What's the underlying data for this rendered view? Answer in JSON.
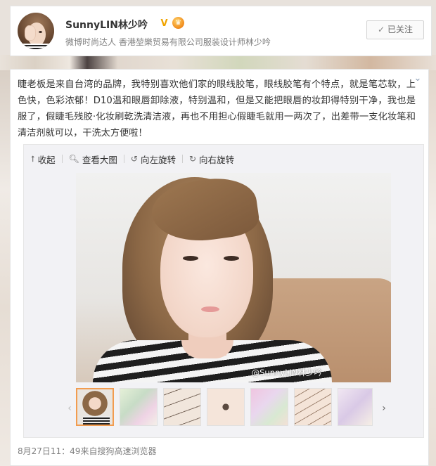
{
  "user": {
    "name": "SunnyLIN林少吟",
    "description": "微博时尚达人 香港堃樂贸易有限公司服装设计师林少吟",
    "follow_label": "已关注"
  },
  "post": {
    "text": "睫老板是来自台湾的品牌，我特别喜欢他们家的眼线胶笔，眼线胶笔有个特点，就是笔芯软，上色快，色彩浓郁！D10温和眼唇卸除液，特别温和，但是又能把眼唇的妆卸得特别干净，我也是服了，假睫毛残胶·化妆刷乾洗清洁液，再也不用担心假睫毛就用一两次了，出差带一支化妆笔和清洁剂就可以，干洗太方便啦！",
    "meta": "8月27日11：49来自搜狗高速浏览器"
  },
  "media": {
    "toolbar": {
      "collapse": "收起",
      "view_large": "查看大图",
      "rotate_left": "向左旋转",
      "rotate_right": "向右旋转"
    },
    "watermark": "@SunnyLIN林少吟",
    "thumbnails_count": 7,
    "active_thumbnail": 1
  },
  "icons": {
    "collapse": "arrow-up-icon",
    "view_large": "magnifier-icon",
    "rotate_left": "rotate-left-icon",
    "rotate_right": "rotate-right-icon",
    "follow": "check-icon",
    "post_menu": "chevron-down-icon"
  },
  "colors": {
    "accent_orange": "#f29c4f",
    "text_gray": "#808080",
    "vip_gold": "#f0a400"
  }
}
